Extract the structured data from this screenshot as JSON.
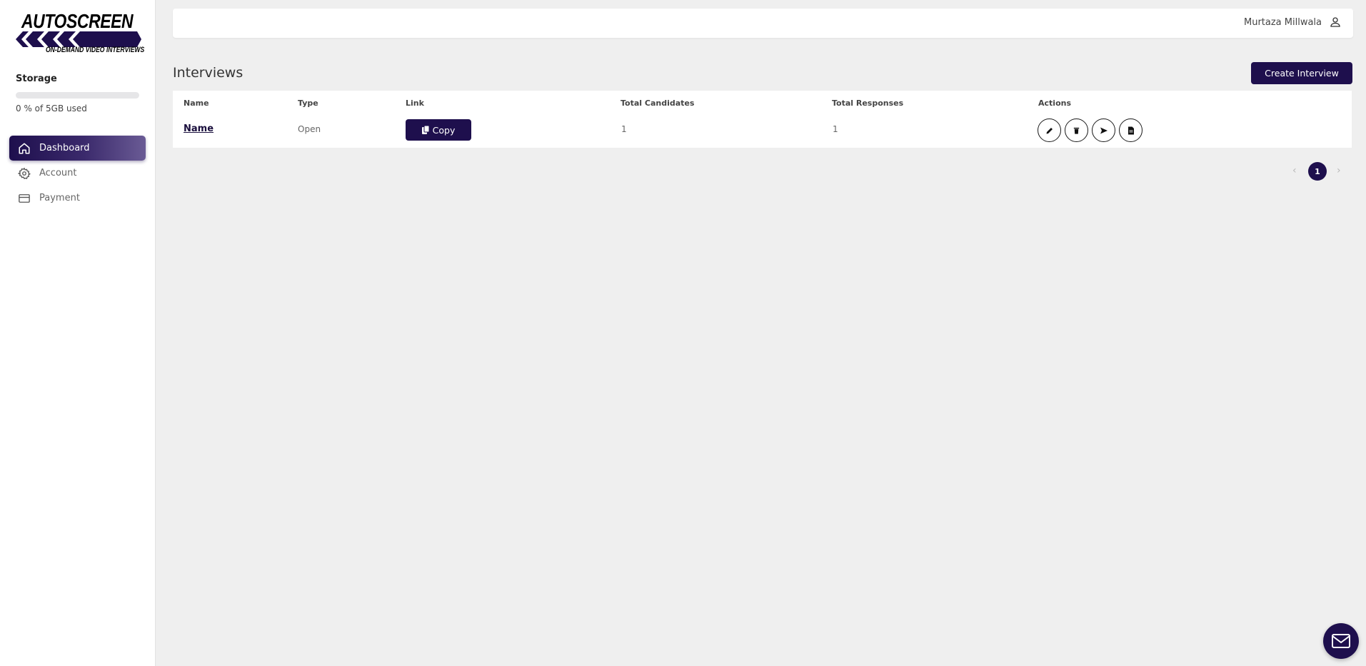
{
  "brand": {
    "title": "AUTOSCREEN",
    "subtitle": "ON-DEMAND VIDEO INTERVIEWS",
    "color": "#1e0f4d"
  },
  "storage": {
    "title": "Storage",
    "used_fraction": 0,
    "usage_text": "0 % of 5GB used"
  },
  "sidebar": {
    "items": [
      {
        "label": "Dashboard",
        "icon": "home-icon",
        "active": true
      },
      {
        "label": "Account",
        "icon": "gear-icon",
        "active": false
      },
      {
        "label": "Payment",
        "icon": "card-icon",
        "active": false
      }
    ]
  },
  "header": {
    "user_name": "Murtaza Millwala",
    "user_icon": "user-icon"
  },
  "main": {
    "title": "Interviews",
    "create_button": "Create Interview",
    "table": {
      "columns": [
        "Name",
        "Type",
        "Link",
        "Total Candidates",
        "Total Responses",
        "Actions"
      ],
      "rows": [
        {
          "name": "Name",
          "type": "Open",
          "link_button": "Copy",
          "total_candidates": "1",
          "total_responses": "1",
          "actions": [
            "edit-icon",
            "delete-icon",
            "send-icon",
            "document-icon"
          ]
        }
      ]
    },
    "pagination": {
      "current_page": "1",
      "prev": "‹",
      "next": "›"
    }
  },
  "fab": {
    "icon": "mail-icon"
  }
}
